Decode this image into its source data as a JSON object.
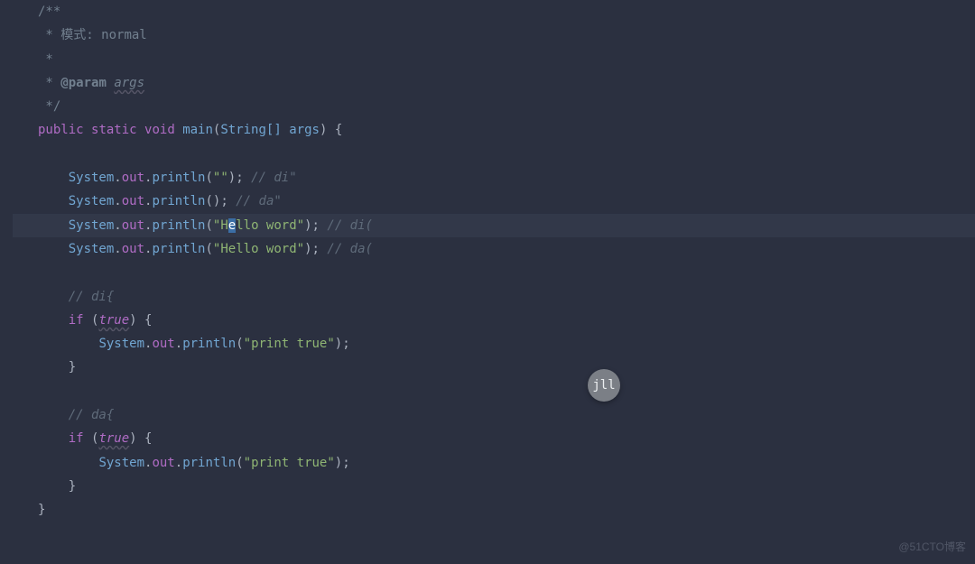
{
  "keycap": "jll",
  "watermark": "@51CTO博客",
  "tokens": {
    "doc_open": "/**",
    "doc_star": " *",
    "doc_mode_label": " 模式: ",
    "doc_mode_value": "normal",
    "doc_param_tag": "@param",
    "doc_param_name": "args",
    "doc_close": " */",
    "kw_public": "public",
    "kw_static": "static",
    "kw_void": "void",
    "kw_if": "if",
    "fn_main": "main",
    "type_string_arr": "String[]",
    "var_args": "args",
    "sys": "System",
    "out": "out",
    "println": "println",
    "str_empty": "\"\"",
    "str_hello_pre": "\"H",
    "str_hello_sel": "e",
    "str_hello_post": "llo word\"",
    "str_hello_full": "\"Hello word\"",
    "str_print_true": "\"print true\"",
    "bool_true": "true",
    "cm_di_q": "// di\"",
    "cm_da_q": "// da\"",
    "cm_di_p": "// di(",
    "cm_da_p": "// da(",
    "cm_di_b": "// di{",
    "cm_da_b": "// da{",
    "sp": " ",
    "dot": ".",
    "lp": "(",
    "rp": ")",
    "lb": "{",
    "rb": "}",
    "semi": ";",
    "ind1": "    ",
    "ind2": "        ",
    "ind3": "            "
  }
}
